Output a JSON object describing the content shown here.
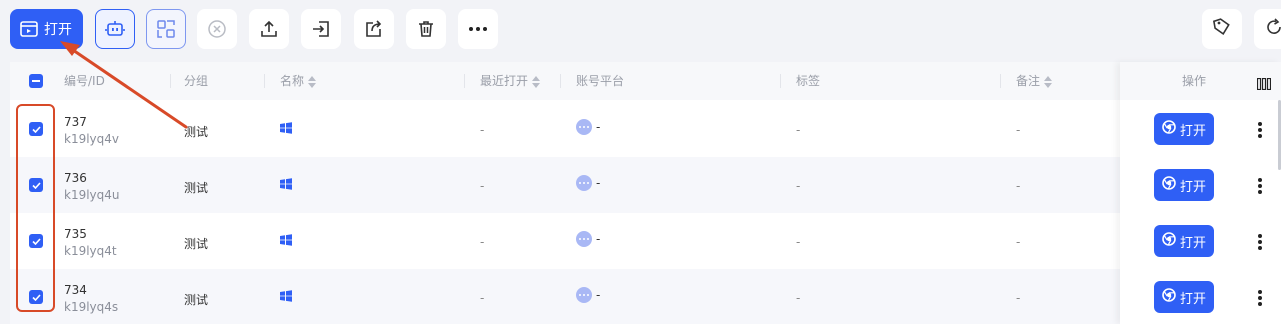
{
  "toolbar": {
    "open_label": "打开",
    "icons": [
      "open-window-icon",
      "bot-icon",
      "qr-scan-icon",
      "close-circle-icon",
      "upload-icon",
      "import-icon",
      "share-icon",
      "trash-icon",
      "more-icon"
    ],
    "right_icons": [
      "tag-icon",
      "refresh-icon"
    ]
  },
  "table": {
    "headers": {
      "id": "编号/ID",
      "group": "分组",
      "name": "名称",
      "last_open": "最近打开",
      "platform": "账号平台",
      "tags": "标签",
      "remark": "备注",
      "ops": "操作"
    },
    "rows": [
      {
        "num": "737",
        "sub": "k19lyq4v",
        "group": "测试",
        "last_open": "-",
        "platform": "-",
        "tags": "-",
        "remark": "-",
        "open": "打开",
        "checked": true
      },
      {
        "num": "736",
        "sub": "k19lyq4u",
        "group": "测试",
        "last_open": "-",
        "platform": "-",
        "tags": "-",
        "remark": "-",
        "open": "打开",
        "checked": true
      },
      {
        "num": "735",
        "sub": "k19lyq4t",
        "group": "测试",
        "last_open": "-",
        "platform": "-",
        "tags": "-",
        "remark": "-",
        "open": "打开",
        "checked": true
      },
      {
        "num": "734",
        "sub": "k19lyq4s",
        "group": "测试",
        "last_open": "-",
        "platform": "-",
        "tags": "-",
        "remark": "-",
        "open": "打开",
        "checked": true
      }
    ]
  },
  "colors": {
    "accent": "#2f5ff5",
    "annotation": "#d84a28"
  }
}
